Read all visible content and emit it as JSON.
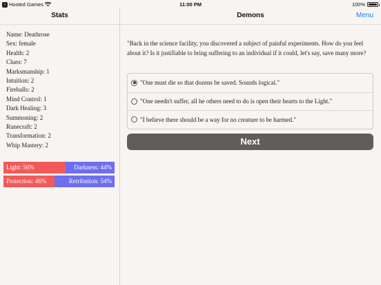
{
  "status_bar": {
    "back_app": "Hosted Games",
    "time": "11:00 PM",
    "battery": "100%",
    "battery_level": 1.0
  },
  "stats_panel": {
    "title": "Stats",
    "lines": [
      "Name: Deathrose",
      "Sex: female",
      "Health: 2",
      "Clues: 7",
      "Marksmanship: 1",
      "Intuition: 2",
      "Fireballs: 2",
      "Mind Control: 1",
      "Dark Healing: 3",
      "Summoning: 2",
      "Runecraft: 2",
      "Transformation: 2",
      "Whip Mastery: 2"
    ],
    "opposed_bars": [
      {
        "left_label": "Light: 56%",
        "right_label": "Darkness: 44%",
        "left_value": 56,
        "left_color": "#f25a5a",
        "right_color": "#6e6ef0"
      },
      {
        "left_label": "Protection: 46%",
        "right_label": "Retribution: 54%",
        "left_value": 46,
        "left_color": "#f25a5a",
        "right_color": "#6e6ef0"
      }
    ]
  },
  "main": {
    "title": "Demons",
    "menu_label": "Menu",
    "question": "\"Back in the science facility, you discovered a subject of painful experiments. How do you feel about it? Is it justifiable to bring suffering to an individual if it could, let's say, save many more?",
    "options": [
      {
        "label": "\"One must die so that dozens be saved. Sounds logical.\"",
        "selected": true
      },
      {
        "label": "\"One needn't suffer, all he others need to do is open their hearts to the Light.\"",
        "selected": false
      },
      {
        "label": "\"I believe there should be a way for no creature to be harmed.\"",
        "selected": false
      }
    ],
    "next_label": "Next"
  }
}
